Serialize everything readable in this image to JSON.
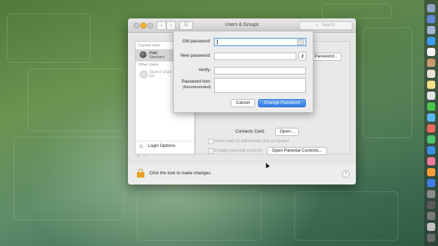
{
  "window": {
    "title": "Users & Groups",
    "search_placeholder": "Search",
    "nav": {
      "back": "‹",
      "forward": "›",
      "grid": "☷"
    }
  },
  "sidebar": {
    "current_user_header": "Current User",
    "other_users_header": "Other Users",
    "users": [
      {
        "name": "mac",
        "role": "Standard"
      },
      {
        "name": "Guest User",
        "role": "Off"
      }
    ],
    "login_options_label": "Login Options",
    "add_label": "+",
    "remove_label": "−"
  },
  "main": {
    "change_password_partial_label": "Password...",
    "contacts_card_label": "Contacts Card:",
    "open_button_label": "Open...",
    "admin_checkbox_label": "Allow user to administer this computer",
    "parental_checkbox_label": "Enable parental controls",
    "open_parental_button_label": "Open Parental Controls..."
  },
  "sheet": {
    "old_password_label": "Old password:",
    "old_password_value": "",
    "new_password_label": "New password:",
    "new_password_value": "",
    "verify_label": "Verify:",
    "verify_value": "",
    "hint_label": "Password hint:",
    "hint_sublabel": "(Recommended)",
    "hint_value": "",
    "cancel_label": "Cancel",
    "change_password_label": "Change Password",
    "key_icon_glyph": "⚷",
    "old_pw_icon_glyph": "⋯"
  },
  "footer": {
    "lock_text": "Click the lock to make changes.",
    "help_label": "?"
  },
  "colors": {
    "accent": "#2f7de9",
    "lock": "#e8a123"
  },
  "icons": [
    "lock-icon",
    "help-icon",
    "key-icon",
    "house-icon",
    "avatar-icon",
    "search-icon"
  ]
}
